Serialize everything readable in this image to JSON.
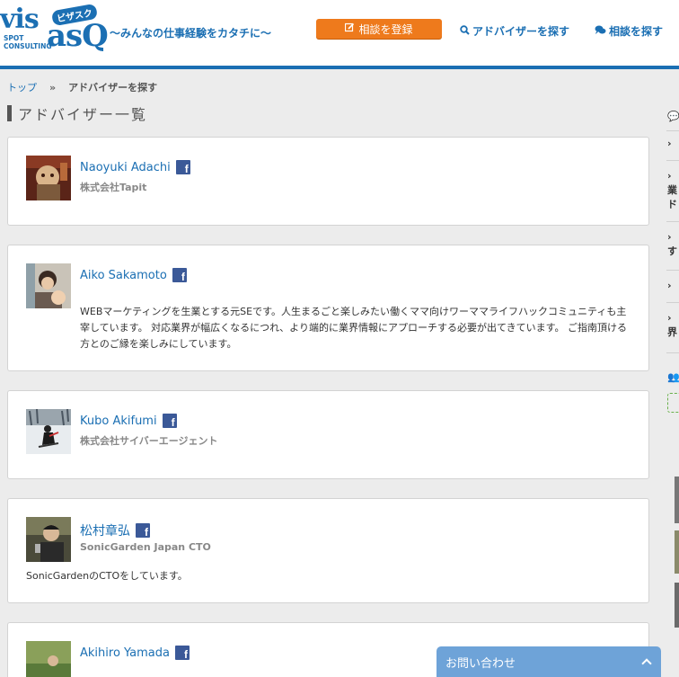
{
  "header": {
    "logo": {
      "main_left": "vis",
      "main_right": "asQ",
      "kana": "ビザスク",
      "sub_line1": "SPOT",
      "sub_line2": "CONSULTING"
    },
    "tagline": "〜みんなの仕事経験をカタチに〜",
    "register_button": "相談を登録",
    "nav_find_advisor": "アドバイザーを探す",
    "nav_find_consult": "相談を探す"
  },
  "breadcrumb": {
    "top": "トップ",
    "separator": "»",
    "current": "アドバイザーを探す"
  },
  "page_title": "アドバイザー一覧",
  "advisors": [
    {
      "name": "Naoyuki Adachi",
      "company": "株式会社Tapit",
      "bio": ""
    },
    {
      "name": "Aiko Sakamoto",
      "company": "",
      "bio": "WEBマーケティングを生業とする元SEです。人生まるごと楽しみたい働くママ向けワーママライフハックコミュニティも主宰しています。 対応業界が幅広くなるにつれ、より端的に業界情報にアプローチする必要が出てきています。 ご指南頂ける方とのご縁を楽しみにしています。"
    },
    {
      "name": "Kubo Akifumi",
      "company": "株式会社サイバーエージェント",
      "bio": ""
    },
    {
      "name": "松村章弘",
      "company": "SonicGarden Japan CTO",
      "bio": "SonicGardenのCTOをしています。"
    },
    {
      "name": "Akihiro Yamada",
      "company": "",
      "bio": ""
    }
  ],
  "icons": {
    "facebook": "f",
    "comment": "💬",
    "search": "⚲",
    "edit": "✎",
    "users": "👥"
  },
  "sidebar": {
    "items": [
      "",
      "",
      "業",
      "ド",
      "",
      "す",
      "",
      "界"
    ]
  },
  "contact": {
    "label": "お問い合わせ"
  },
  "colors": {
    "brand_blue": "#1b6fb3",
    "orange": "#ee7a1c",
    "facebook": "#3b5998",
    "contact_bar": "#6ea3d8",
    "page_bg": "#ececec"
  }
}
